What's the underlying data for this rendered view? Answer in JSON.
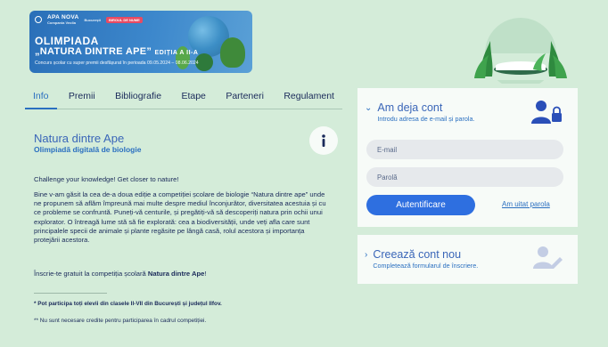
{
  "banner": {
    "logo_main": "APA NOVA",
    "logo_sub": "Compania Veolia",
    "logo_mid": "București",
    "logo_right": "BIROUL DE NUME",
    "title_line1": "OLIMPIADA",
    "title_line2": "„NATURA DINTRE APE”",
    "title_edition": "EDIȚIA A II-A",
    "subtitle": "Concurs școlar cu super premii desfășurat în perioada 09.05.2024 – 08.06.2024"
  },
  "tabs": [
    {
      "label": "Info",
      "active": true
    },
    {
      "label": "Premii",
      "active": false
    },
    {
      "label": "Bibliografie",
      "active": false
    },
    {
      "label": "Etape",
      "active": false
    },
    {
      "label": "Parteneri",
      "active": false
    },
    {
      "label": "Regulament",
      "active": false
    }
  ],
  "content": {
    "title": "Natura dintre Ape",
    "subtitle": "Olimpiadă digitală de biologie",
    "p1": "Challenge your knowledge! Get closer to nature!",
    "p2": "Bine v-am găsit la cea de-a doua ediție a competiției școlare de biologie “Natura dintre ape” unde ne propunem să aflăm împreună mai multe despre mediul înconjurător, diversitatea acestuia și cu ce probleme se confruntă. Puneți-vă centurile, și pregătiți-vă să descoperiți natura prin ochii unui explorator. O întreagă lume stă să fie explorată: cea a biodiversității, unde veți afla care sunt principalele specii de animale și plante regăsite pe lângă casă, rolul acestora și importanța protejării acestora.",
    "p3_prefix": "Înscrie-te gratuit la competiția școlară ",
    "p3_bold": "Natura dintre Ape",
    "p3_suffix": "!",
    "note1": "* Pot participa toți elevii din clasele II-VII din București și județul Ilfov.",
    "note2": "** Nu sunt necesare credite pentru participarea în cadrul competiției."
  },
  "login": {
    "title": "Am deja cont",
    "subtitle": "Introdu adresa de e-mail și parola.",
    "email_placeholder": "E-mail",
    "password_placeholder": "Parolă",
    "submit_label": "Autentificare",
    "forgot_label": "Am uitat parola"
  },
  "register": {
    "title": "Creează cont nou",
    "subtitle": "Completează formularul de înscriere."
  },
  "colors": {
    "background": "#d4ecd9",
    "accent": "#2a6fc0",
    "button": "#2e6fe0"
  }
}
